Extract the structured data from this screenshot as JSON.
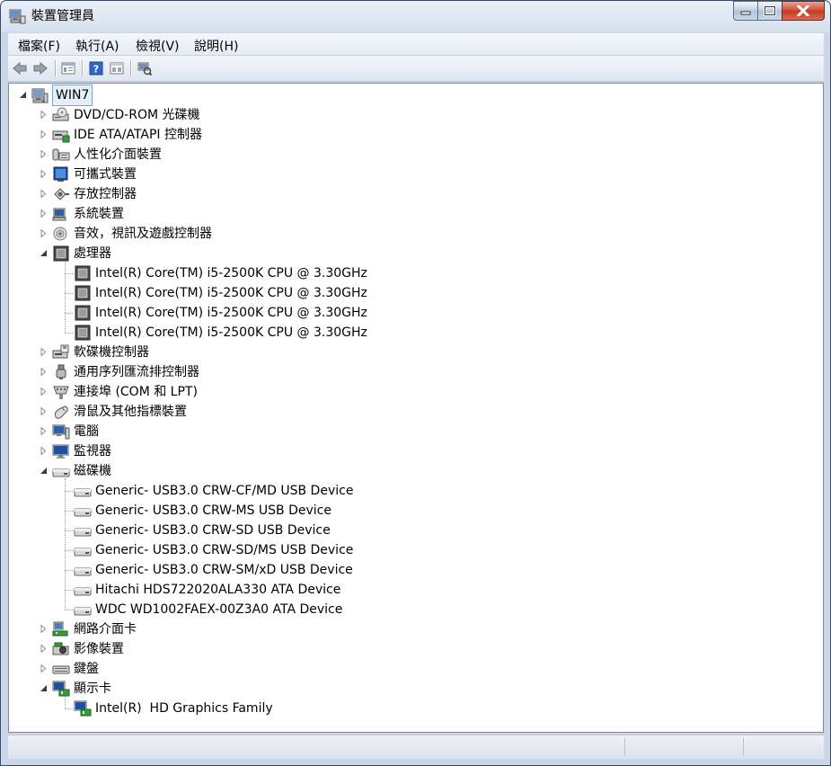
{
  "window": {
    "title": "裝置管理員"
  },
  "menu": [
    "檔案(F)",
    "執行(A)",
    "檢視(V)",
    "說明(H)"
  ],
  "toolbar": {
    "buttons": [
      "back-arrow-icon",
      "forward-arrow-icon",
      "properties-icon",
      "help-icon",
      "view-icon",
      "scan-hardware-icon"
    ]
  },
  "tree": {
    "root": "WIN7",
    "categories": [
      {
        "label": "DVD/CD-ROM 光碟機",
        "icon": "dvd-drive-icon",
        "expanded": false
      },
      {
        "label": "IDE ATA/ATAPI 控制器",
        "icon": "ide-controller-icon",
        "expanded": false
      },
      {
        "label": "人性化介面裝置",
        "icon": "hid-device-icon",
        "expanded": false
      },
      {
        "label": "可攜式裝置",
        "icon": "portable-device-icon",
        "expanded": false
      },
      {
        "label": "存放控制器",
        "icon": "storage-controller-icon",
        "expanded": false
      },
      {
        "label": "系統裝置",
        "icon": "system-device-icon",
        "expanded": false
      },
      {
        "label": "音效，視訊及遊戲控制器",
        "icon": "sound-icon",
        "expanded": false
      },
      {
        "label": "處理器",
        "icon": "processor-icon",
        "expanded": true,
        "children": [
          "Intel(R) Core(TM) i5-2500K CPU @ 3.30GHz",
          "Intel(R) Core(TM) i5-2500K CPU @ 3.30GHz",
          "Intel(R) Core(TM) i5-2500K CPU @ 3.30GHz",
          "Intel(R) Core(TM) i5-2500K CPU @ 3.30GHz"
        ],
        "child_icon": "processor-icon"
      },
      {
        "label": "軟碟機控制器",
        "icon": "floppy-controller-icon",
        "expanded": false
      },
      {
        "label": "通用序列匯流排控制器",
        "icon": "usb-icon",
        "expanded": false
      },
      {
        "label": "連接埠 (COM 和 LPT)",
        "icon": "port-icon",
        "expanded": false
      },
      {
        "label": "滑鼠及其他指標裝置",
        "icon": "mouse-icon",
        "expanded": false
      },
      {
        "label": "電腦",
        "icon": "computer-icon",
        "expanded": false
      },
      {
        "label": "監視器",
        "icon": "monitor-icon",
        "expanded": false
      },
      {
        "label": "磁碟機",
        "icon": "disk-drive-icon",
        "expanded": true,
        "children": [
          "Generic- USB3.0 CRW-CF/MD USB Device",
          "Generic- USB3.0 CRW-MS USB Device",
          "Generic- USB3.0 CRW-SD USB Device",
          "Generic- USB3.0 CRW-SD/MS USB Device",
          "Generic- USB3.0 CRW-SM/xD USB Device",
          "Hitachi HDS722020ALA330 ATA Device",
          "WDC WD1002FAEX-00Z3A0 ATA Device"
        ],
        "child_icon": "disk-drive-icon"
      },
      {
        "label": "網路介面卡",
        "icon": "network-adapter-icon",
        "expanded": false
      },
      {
        "label": "影像裝置",
        "icon": "imaging-device-icon",
        "expanded": false
      },
      {
        "label": "鍵盤",
        "icon": "keyboard-icon",
        "expanded": false
      },
      {
        "label": "顯示卡",
        "icon": "display-adapter-icon",
        "expanded": true,
        "children": [
          "Intel(R)  HD Graphics Family"
        ],
        "child_icon": "display-adapter-icon"
      }
    ]
  },
  "statusbar": {
    "text": ""
  }
}
